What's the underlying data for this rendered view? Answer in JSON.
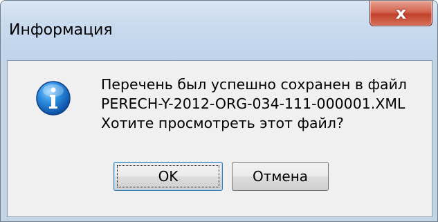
{
  "window": {
    "title": "Информация",
    "close_icon": "close-icon",
    "close_label": "x"
  },
  "message": {
    "icon": "information-icon",
    "line1": "Перечень был успешно сохранен в файл",
    "line2": "PERECH-Y-2012-ORG-034-111-000001.XML",
    "line3": "Хотите просмотреть этот файл?"
  },
  "buttons": {
    "ok_label": "OK",
    "cancel_label": "Отмена"
  },
  "colors": {
    "titlebar": "#c9daee",
    "close_button": "#c1412b",
    "client_area": "#f0f0f0",
    "info_icon": "#1f6fc0"
  }
}
